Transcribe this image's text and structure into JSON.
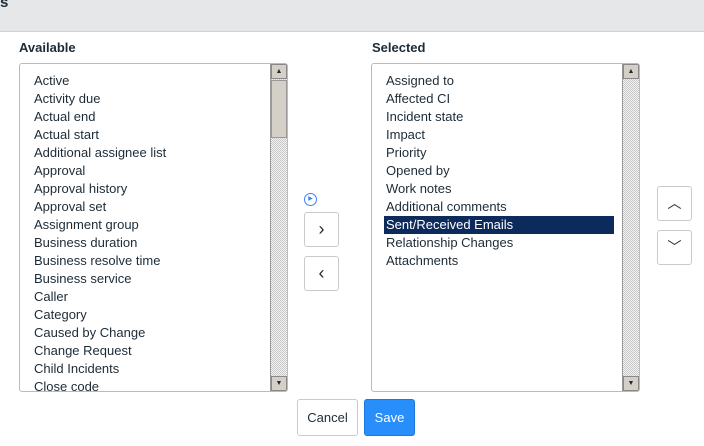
{
  "header": {
    "title": "s"
  },
  "available": {
    "label": "Available",
    "items": [
      "Active",
      "Activity due",
      "Actual end",
      "Actual start",
      "Additional assignee list",
      "Approval",
      "Approval history",
      "Approval set",
      "Assignment group",
      "Business duration",
      "Business resolve time",
      "Business service",
      "Caller",
      "Category",
      "Caused by Change",
      "Change Request",
      "Child Incidents",
      "Close code"
    ]
  },
  "selected": {
    "label": "Selected",
    "items": [
      "Assigned to",
      "Affected CI",
      "Incident state",
      "Impact",
      "Priority",
      "Opened by",
      "Work notes",
      "Additional comments",
      "Sent/Received Emails",
      "Relationship Changes",
      "Attachments"
    ],
    "selected_item": "Sent/Received Emails"
  },
  "buttons": {
    "add": "›",
    "remove": "‹",
    "up": "︿",
    "down": "﹀",
    "cancel": "Cancel",
    "save": "Save"
  },
  "colors": {
    "accent": "#278efc",
    "selection": "#0d2a5c"
  }
}
